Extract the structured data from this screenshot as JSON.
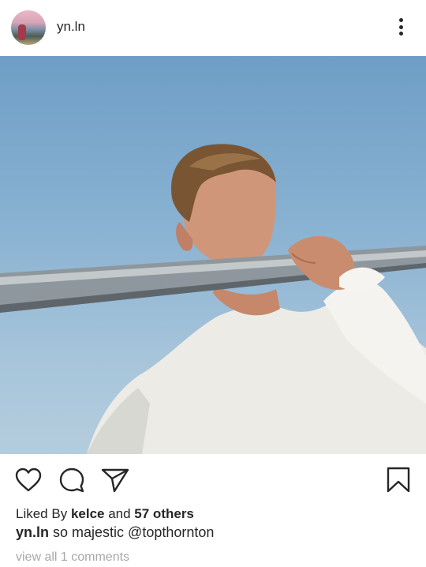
{
  "post": {
    "username": "yn.ln",
    "avatar_icon": "avatar-photo",
    "more_icon": "more-vertical-icon"
  },
  "actions": {
    "like_icon": "heart-icon",
    "comment_icon": "comment-icon",
    "share_icon": "send-icon",
    "save_icon": "bookmark-icon"
  },
  "likes": {
    "prefix": "Liked By ",
    "user": "kelce",
    "conj": " and ",
    "others": "57 others"
  },
  "caption": {
    "username": "yn.ln",
    "text": " so majestic @topthornton"
  },
  "comments": {
    "link_text": "view all 1 comments"
  },
  "colors": {
    "text": "#262626",
    "muted": "#a8a8a8",
    "sky": "#8bb3d2"
  }
}
